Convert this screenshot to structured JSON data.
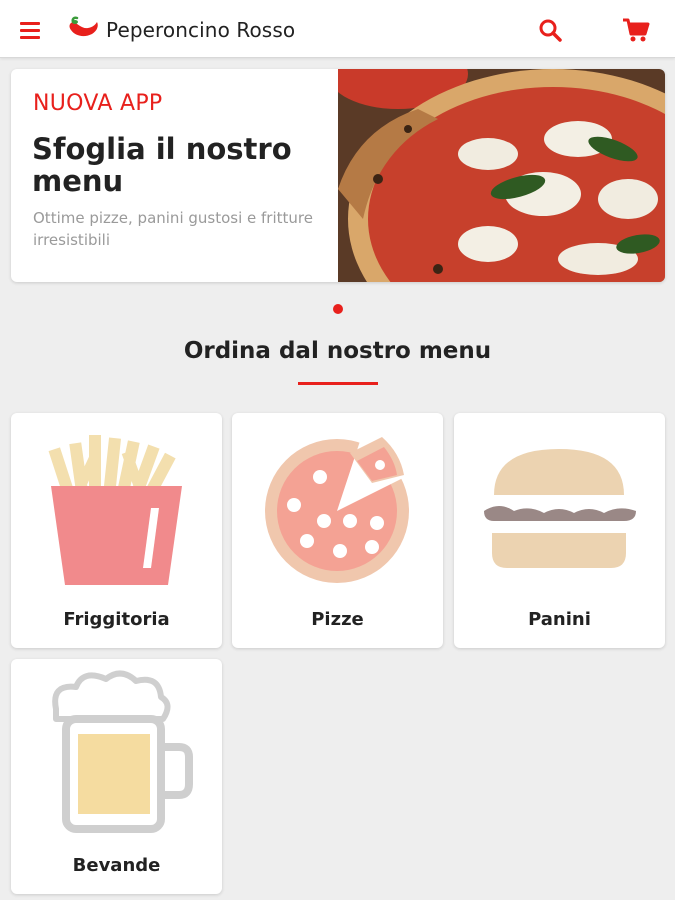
{
  "header": {
    "brand": "Peperoncino Rosso",
    "icons": {
      "menu": "hamburger-menu-icon",
      "logo": "chili-pepper-icon",
      "search": "search-icon",
      "cart": "shopping-cart-icon"
    },
    "accent_color": "#e8201c"
  },
  "hero": {
    "badge": "NUOVA APP",
    "title": "Sfoglia il nostro menu",
    "subtitle": "Ottime pizze, panini gustosi e fritture irresistibili",
    "image": "pizza-photo"
  },
  "carousel": {
    "current_slide": 1,
    "total_slides": 1
  },
  "menu_section": {
    "title": "Ordina dal nostro menu",
    "categories": [
      {
        "label": "Friggitoria",
        "icon": "french-fries-icon"
      },
      {
        "label": "Pizze",
        "icon": "pizza-icon"
      },
      {
        "label": "Panini",
        "icon": "burger-icon"
      },
      {
        "label": "Bevande",
        "icon": "beer-mug-icon"
      }
    ]
  }
}
